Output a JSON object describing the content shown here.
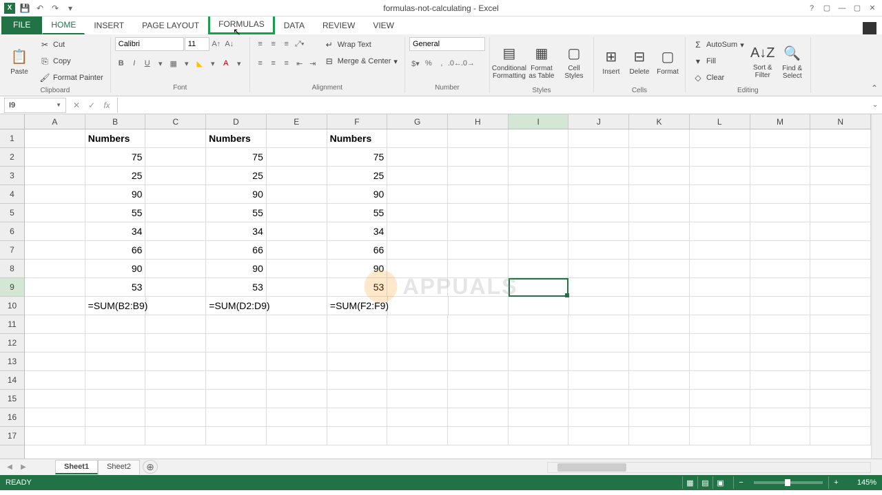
{
  "title": "formulas-not-calculating - Excel",
  "tabs": {
    "file": "FILE",
    "home": "HOME",
    "insert": "INSERT",
    "pagelayout": "PAGE LAYOUT",
    "formulas": "FORMULAS",
    "data": "DATA",
    "review": "REVIEW",
    "view": "VIEW"
  },
  "clipboard": {
    "paste": "Paste",
    "cut": "Cut",
    "copy": "Copy",
    "formatpainter": "Format Painter",
    "label": "Clipboard"
  },
  "font": {
    "name": "Calibri",
    "size": "11",
    "label": "Font"
  },
  "alignment": {
    "wrap": "Wrap Text",
    "merge": "Merge & Center",
    "label": "Alignment"
  },
  "number": {
    "format": "General",
    "label": "Number"
  },
  "styles": {
    "conditional": "Conditional Formatting",
    "table": "Format as Table",
    "cell": "Cell Styles",
    "label": "Styles"
  },
  "cells": {
    "insert": "Insert",
    "delete": "Delete",
    "format": "Format",
    "label": "Cells"
  },
  "editing": {
    "autosum": "AutoSum",
    "fill": "Fill",
    "clear": "Clear",
    "sort": "Sort & Filter",
    "find": "Find & Select",
    "label": "Editing"
  },
  "namebox": "I9",
  "columns": [
    "A",
    "B",
    "C",
    "D",
    "E",
    "F",
    "G",
    "H",
    "I",
    "J",
    "K",
    "L",
    "M",
    "N"
  ],
  "grid": {
    "header": "Numbers",
    "values": [
      75,
      25,
      90,
      55,
      34,
      66,
      90,
      53
    ],
    "formulas": {
      "b": "=SUM(B2:B9)",
      "d": "=SUM(D2:D9)",
      "f": "=SUM(F2:F9)"
    }
  },
  "sheets": {
    "s1": "Sheet1",
    "s2": "Sheet2"
  },
  "status": {
    "ready": "READY",
    "zoom": "145%"
  },
  "chart_data": {
    "type": "table",
    "columns": [
      "B",
      "D",
      "F"
    ],
    "header_row": [
      "Numbers",
      "Numbers",
      "Numbers"
    ],
    "rows": [
      [
        75,
        75,
        75
      ],
      [
        25,
        25,
        25
      ],
      [
        90,
        90,
        90
      ],
      [
        55,
        55,
        55
      ],
      [
        34,
        34,
        34
      ],
      [
        66,
        66,
        66
      ],
      [
        90,
        90,
        90
      ],
      [
        53,
        53,
        53
      ]
    ],
    "formula_row": [
      "=SUM(B2:B9)",
      "=SUM(D2:D9)",
      "=SUM(F2:F9)"
    ],
    "selected_cell": "I9"
  }
}
